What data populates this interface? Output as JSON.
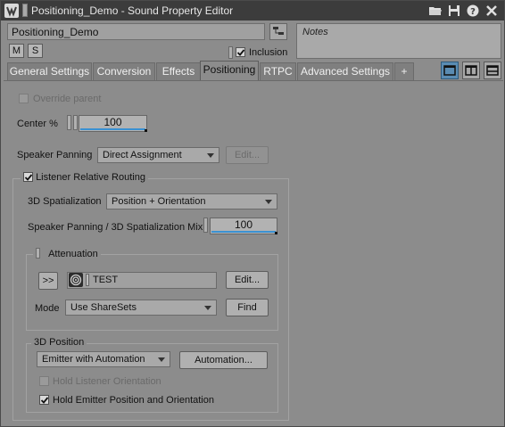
{
  "window": {
    "title": "Positioning_Demo - Sound Property Editor",
    "toolbar_icons": [
      "folder-icon",
      "save-icon",
      "help-icon",
      "close-icon"
    ]
  },
  "object": {
    "name": "Positioning_Demo",
    "mute_label": "M",
    "solo_label": "S",
    "inclusion_label": "Inclusion",
    "inclusion_checked": true
  },
  "notes": {
    "placeholder": "Notes"
  },
  "tabs": [
    {
      "label": "General Settings",
      "active": false
    },
    {
      "label": "Conversion",
      "active": false
    },
    {
      "label": "Effects",
      "active": false
    },
    {
      "label": "Positioning",
      "active": true
    },
    {
      "label": "RTPC",
      "active": false
    },
    {
      "label": "Advanced Settings",
      "active": false
    },
    {
      "label": "+",
      "active": false
    }
  ],
  "layout_buttons": [
    "layout-single-icon",
    "layout-split-vertical-icon",
    "layout-split-horizontal-icon"
  ],
  "positioning": {
    "override_parent_label": "Override parent",
    "center_label": "Center %",
    "center_value": "100",
    "speaker_panning_label": "Speaker Panning",
    "speaker_panning_value": "Direct Assignment",
    "speaker_panning_edit": "Edit...",
    "listener_routing_label": "Listener Relative Routing",
    "listener_routing_checked": true,
    "spatialization_label": "3D Spatialization",
    "spatialization_value": "Position + Orientation",
    "mix_label": "Speaker Panning / 3D Spatialization Mix",
    "mix_value": "100",
    "attenuation": {
      "title": "Attenuation",
      "expand_label": ">>",
      "shareset_name": "TEST",
      "edit_label": "Edit...",
      "mode_label": "Mode",
      "mode_value": "Use ShareSets",
      "find_label": "Find"
    },
    "position3d": {
      "title": "3D Position",
      "source_value": "Emitter with Automation",
      "automation_label": "Automation...",
      "hold_listener_label": "Hold Listener Orientation",
      "hold_listener_checked": false,
      "hold_emitter_label": "Hold Emitter Position and Orientation",
      "hold_emitter_checked": true
    }
  },
  "colors": {
    "accent": "#3a91d2",
    "panel": "#8c8c8c",
    "titlebar": "#3c3c3c"
  }
}
